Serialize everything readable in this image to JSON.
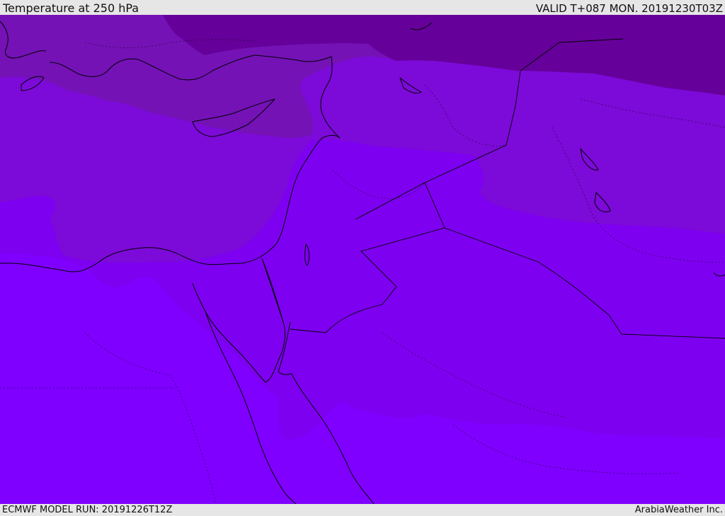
{
  "header": {
    "title": "Temperature at 250 hPa",
    "valid": "VALID T+087 MON. 20191230T03Z"
  },
  "footer": {
    "model_run": "ECMWF MODEL RUN: 20191226T12Z",
    "credit": "ArabiaWeather Inc."
  },
  "colors": {
    "band_coldest": "#65009a",
    "band_cold": "#7412b6",
    "band_mid": "#7c0ad8",
    "band_warm": "#7e00f0",
    "band_warmest": "#7f00ff",
    "coastline": "#000000"
  }
}
